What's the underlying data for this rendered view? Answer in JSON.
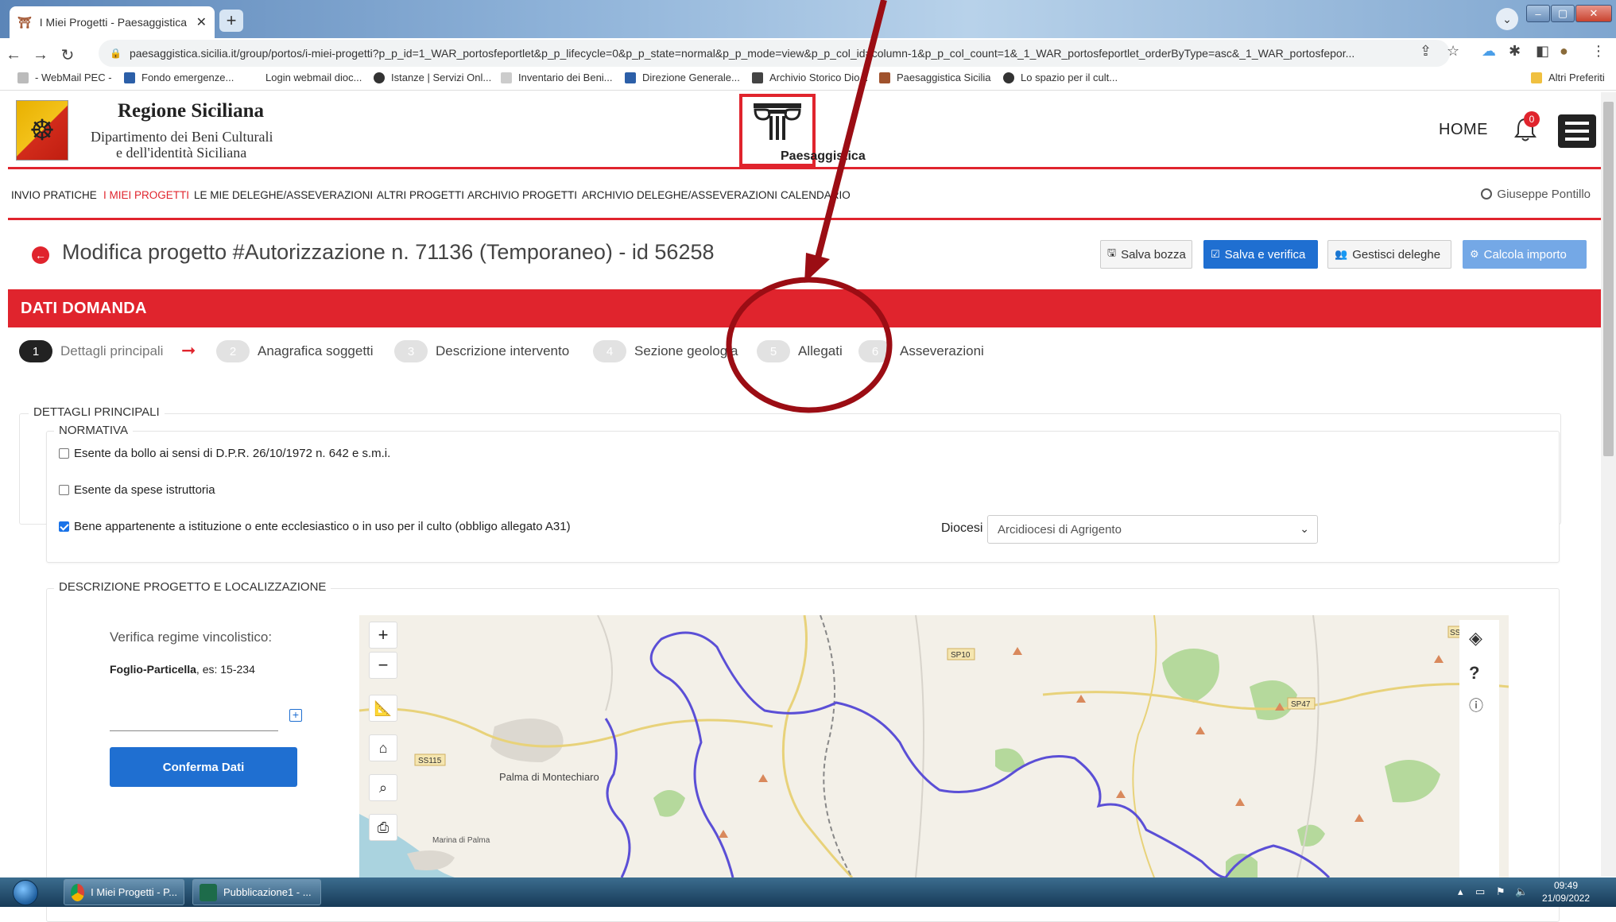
{
  "browser": {
    "tab_title": "I Miei Progetti - Paesaggistica Si",
    "url": "paesaggistica.sicilia.it/group/portos/i-miei-progetti?p_p_id=1_WAR_portosfeportlet&p_p_lifecycle=0&p_p_state=normal&p_p_mode=view&p_p_col_id=column-1&p_p_col_count=1&_1_WAR_portosfeportlet_orderByType=asc&_1_WAR_portosfepor...",
    "bookmarks": [
      "- WebMail PEC -",
      "Fondo emergenze...",
      "Login webmail dioc...",
      "Istanze | Servizi Onl...",
      "Inventario dei Beni...",
      "Direzione Generale...",
      "Archivio Storico Dio...",
      "Paesaggistica Sicilia",
      "Lo spazio per il cult..."
    ],
    "other_bookmarks": "Altri Preferiti"
  },
  "header": {
    "title": "Regione Siciliana",
    "subtitle_line1": "Dipartimento dei Beni Culturali",
    "subtitle_line2": "e dell'identità Siciliana",
    "brand": "Paesaggistica",
    "home": "HOME",
    "notifications": "0"
  },
  "nav": {
    "items": [
      "INVIO PRATICHE",
      "I MIEI PROGETTI",
      "LE MIE DELEGHE/ASSEVERAZIONI",
      "ALTRI PROGETTI",
      "ARCHIVIO PROGETTI",
      "ARCHIVIO DELEGHE/ASSEVERAZIONI",
      "CALENDARIO"
    ],
    "active_index": 1,
    "user": "Giuseppe Pontillo"
  },
  "page": {
    "title": "Modifica progetto #Autorizzazione n. 71136 (Temporaneo) - id 56258",
    "buttons": {
      "save_draft": "Salva bozza",
      "save_verify": "Salva e verifica",
      "manage_delegations": "Gestisci deleghe",
      "calculate": "Calcola importo"
    },
    "banner": "DATI DOMANDA"
  },
  "steps": [
    {
      "num": "1",
      "label": "Dettagli principali",
      "done": true
    },
    {
      "num": "2",
      "label": "Anagrafica soggetti",
      "done": false
    },
    {
      "num": "3",
      "label": "Descrizione intervento",
      "done": false
    },
    {
      "num": "4",
      "label": "Sezione geologia",
      "done": false
    },
    {
      "num": "5",
      "label": "Allegati",
      "done": false
    },
    {
      "num": "6",
      "label": "Asseverazioni",
      "done": false
    }
  ],
  "dettagli": {
    "legend": "DETTAGLI PRINCIPALI",
    "normativa_legend": "NORMATIVA",
    "checkbox_bollo": "Esente da bollo ai sensi di D.P.R. 26/10/1972 n. 642 e s.m.i.",
    "checkbox_spese": "Esente da spese istruttoria",
    "checkbox_bene": "Bene appartenente a istituzione o ente ecclesiastico o in uso per il culto (obbligo allegato A31)",
    "diocesi_label": "Diocesi",
    "diocesi_value": "Arcidiocesi di Agrigento"
  },
  "descrizione": {
    "legend": "DESCRIZIONE PROGETTO E LOCALIZZAZIONE",
    "verifica_label": "Verifica regime vincolistico:",
    "foglio_bold": "Foglio-Particella",
    "foglio_hint": ", es: 15-234",
    "conferma": "Conferma Dati"
  },
  "map": {
    "labels": {
      "sp10": "SP10",
      "ss115": "SS115",
      "sp47": "SP47",
      "palma": "Palma di Montechiaro",
      "marina": "Marina di Palma",
      "ss": "SS"
    },
    "colors": {
      "boundary": "#5b4fd6",
      "forest": "#a9d08e",
      "road": "#e8d27a"
    }
  },
  "taskbar": {
    "task1": "I Miei Progetti - P...",
    "task2": "Pubblicazione1 - ...",
    "time": "09:49",
    "date": "21/09/2022"
  },
  "colors": {
    "accent_red": "#e0242d",
    "primary_blue": "#1f6fd1",
    "annotation": "#9b0d14"
  }
}
